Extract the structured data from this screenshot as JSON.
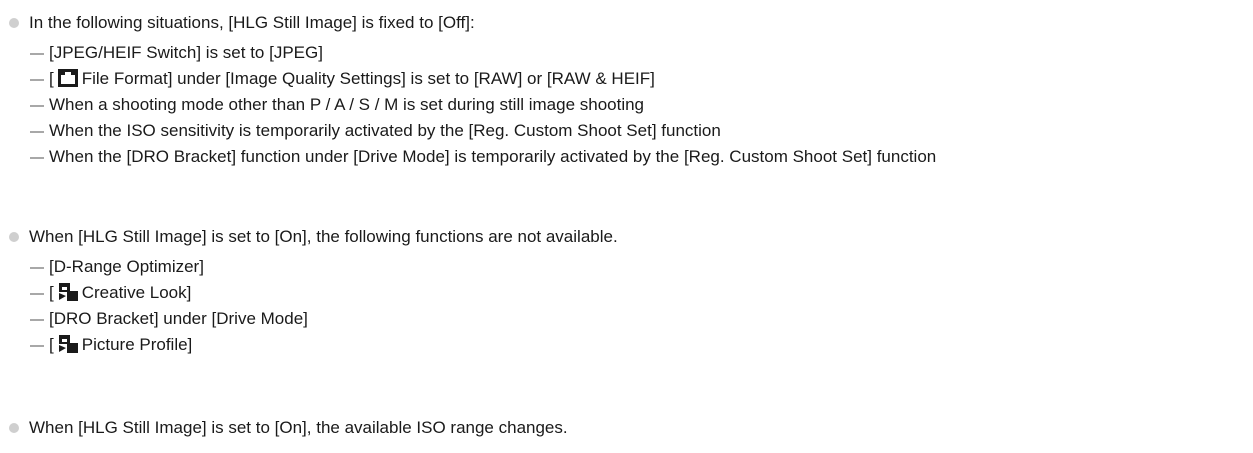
{
  "notes": [
    {
      "text": "In the following situations, [HLG Still Image] is fixed to [Off]:",
      "items": [
        {
          "text": "[JPEG/HEIF Switch] is set to [JPEG]"
        },
        {
          "prefix": "[",
          "icon": "camera-still-icon",
          "text": "File Format] under [Image Quality Settings] is set to [RAW] or [RAW & HEIF]"
        },
        {
          "text": "When a shooting mode other than P / A / S / M is set during still image shooting"
        },
        {
          "text": "When the ISO sensitivity is temporarily activated by the [Reg. Custom Shoot Set] function"
        },
        {
          "text": "When the [DRO Bracket] function under [Drive Mode] is temporarily activated by the [Reg. Custom Shoot Set] function"
        }
      ]
    },
    {
      "text": "When [HLG Still Image] is set to [On], the following functions are not available.",
      "items": [
        {
          "text": "[D-Range Optimizer]"
        },
        {
          "prefix": "[",
          "icon": "still-movie-icon",
          "text": "Creative Look]"
        },
        {
          "text": "[DRO Bracket] under [Drive Mode]"
        },
        {
          "prefix": "[",
          "icon": "still-movie-icon",
          "text": "Picture Profile]"
        }
      ]
    },
    {
      "text": "When [HLG Still Image] is set to [On], the available ISO range changes.",
      "items": []
    }
  ]
}
